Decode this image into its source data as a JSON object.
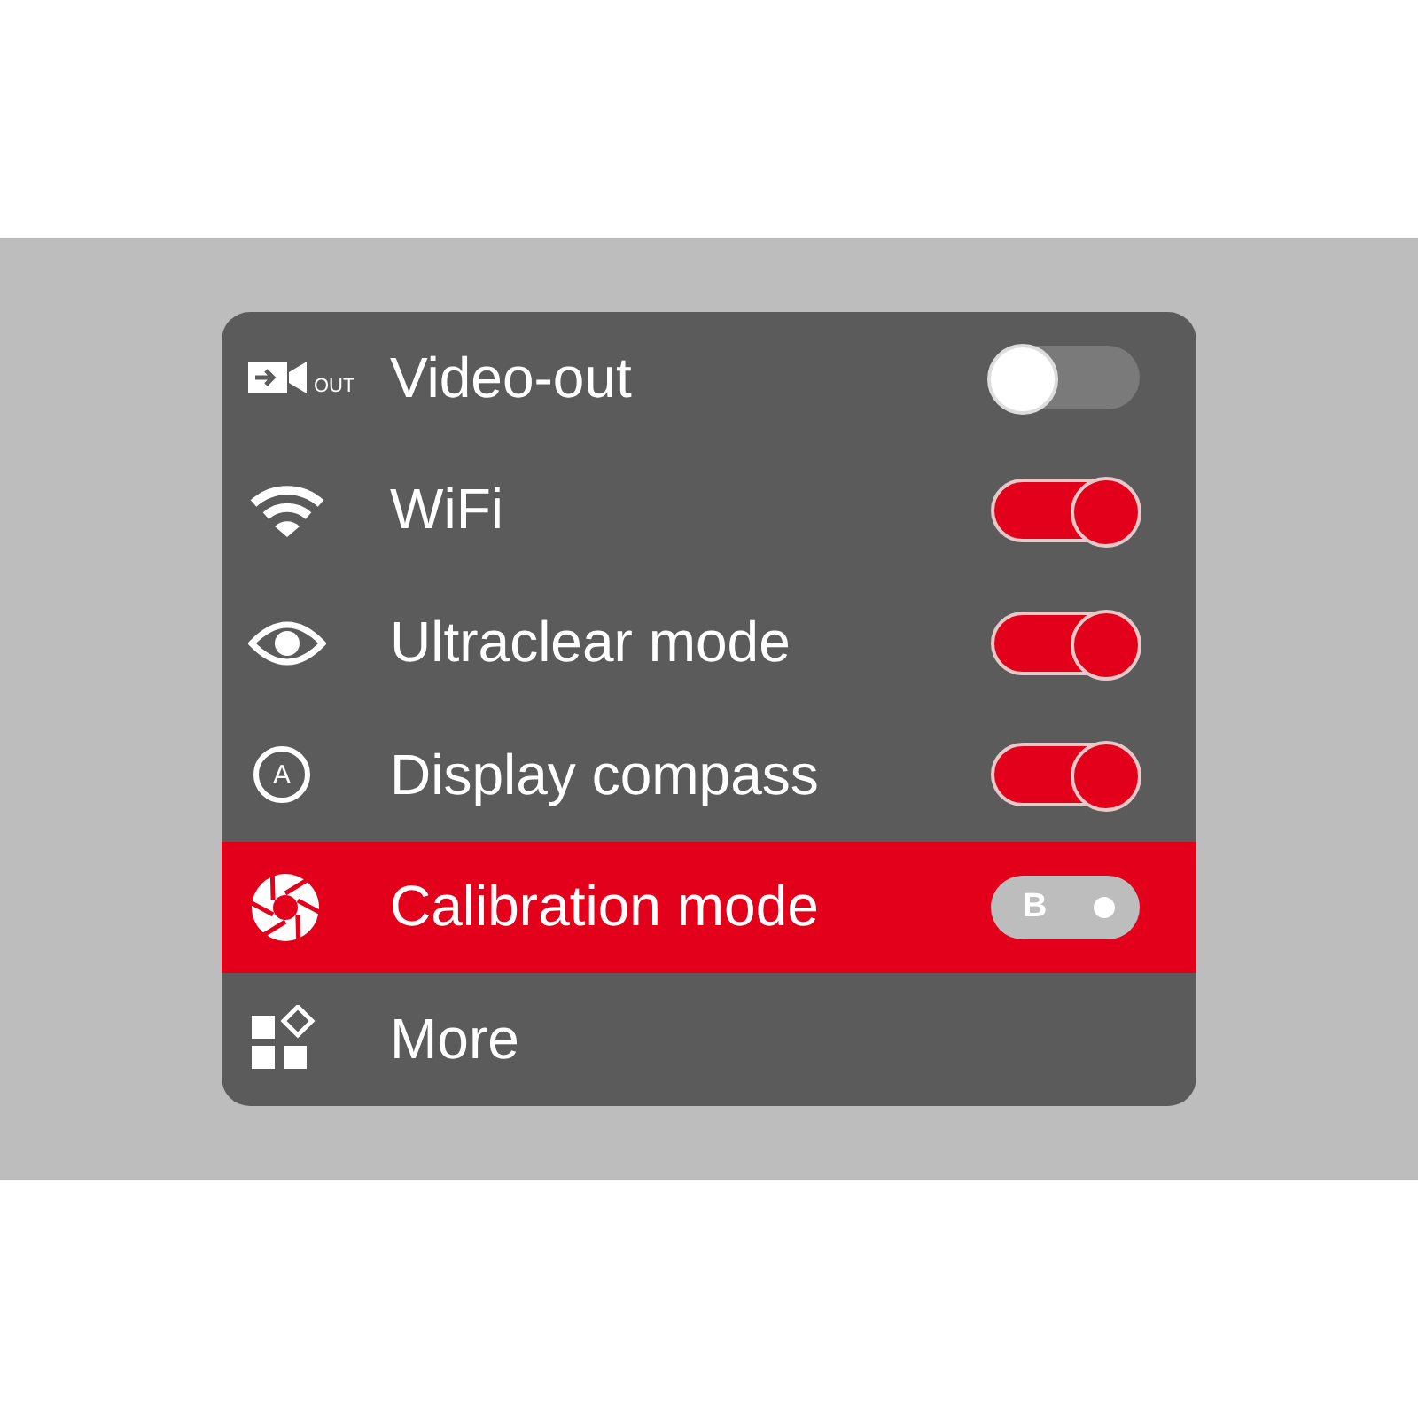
{
  "menu": {
    "items": [
      {
        "kind": "switch",
        "icon_text": "OUT",
        "label": "Video-out",
        "on": false,
        "selected": false
      },
      {
        "kind": "switch",
        "label": "WiFi",
        "on": true,
        "selected": false
      },
      {
        "kind": "switch",
        "label": "Ultraclear mode",
        "on": true,
        "selected": false
      },
      {
        "kind": "switch",
        "icon_text": "A",
        "label": "Display compass",
        "on": true,
        "selected": false
      },
      {
        "kind": "mode",
        "label": "Calibration mode",
        "mode": "B",
        "selected": true
      },
      {
        "kind": "link",
        "label": "More",
        "selected": false
      }
    ]
  }
}
